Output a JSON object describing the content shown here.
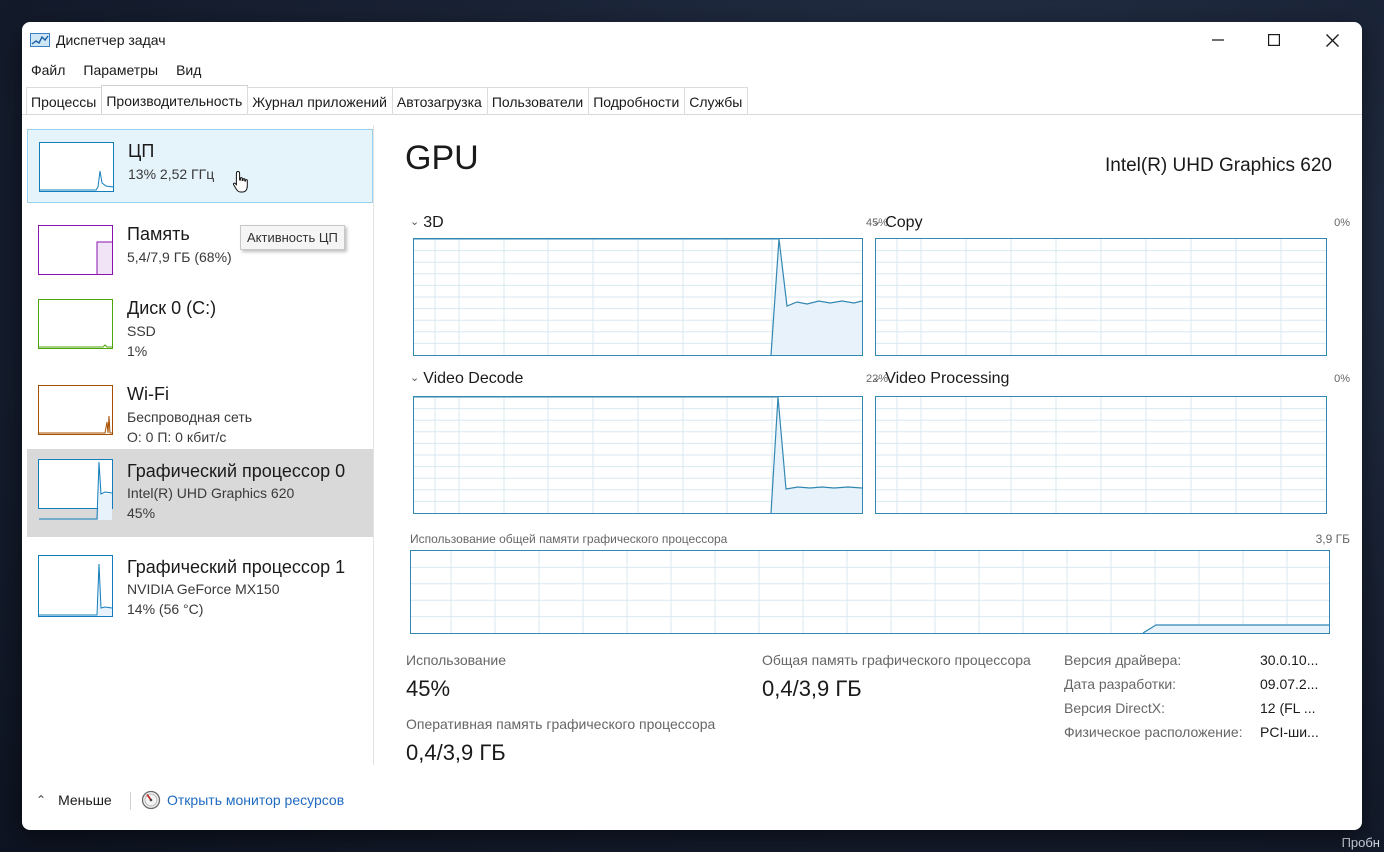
{
  "window": {
    "title": "Диспетчер задач"
  },
  "menu": [
    "Файл",
    "Параметры",
    "Вид"
  ],
  "tabs": [
    "Процессы",
    "Производительность",
    "Журнал приложений",
    "Автозагрузка",
    "Пользователи",
    "Подробности",
    "Службы"
  ],
  "sidebar": [
    {
      "name": "ЦП",
      "line1": "13%  2,52 ГГц",
      "line2": "",
      "color": "#117dbb"
    },
    {
      "name": "Память",
      "line1": "5,4/7,9 ГБ (68%)",
      "line2": "",
      "color": "#8b12ae"
    },
    {
      "name": "Диск 0 (C:)",
      "line1": "SSD",
      "line2": "1%",
      "color": "#4da60c"
    },
    {
      "name": "Wi-Fi",
      "line1": "Беспроводная сеть",
      "line2": "О: 0  П: 0 кбит/с",
      "color": "#a74f01"
    },
    {
      "name": "Графический процессор 0",
      "line1": "Intel(R) UHD Graphics 620",
      "line2": "45%",
      "color": "#117dbb"
    },
    {
      "name": "Графический процессор 1",
      "line1": "NVIDIA GeForce MX150",
      "line2": "14%  (56 °C)",
      "color": "#117dbb"
    }
  ],
  "tooltip": "Активность ЦП",
  "main": {
    "title": "GPU",
    "model": "Intel(R) UHD Graphics 620",
    "engines": [
      {
        "name": "3D",
        "percent": "45%"
      },
      {
        "name": "Copy",
        "percent": "0%"
      },
      {
        "name": "Video Decode",
        "percent": "22%"
      },
      {
        "name": "Video Processing",
        "percent": "0%"
      }
    ],
    "shared_memory": {
      "label": "Использование общей памяти графического процессора",
      "max": "3,9 ГБ"
    },
    "stats": {
      "usage_label": "Использование",
      "usage_value": "45%",
      "shared_label": "Общая память графического процессора",
      "shared_value": "0,4/3,9 ГБ",
      "dedicated_label": "Оперативная память графического процессора",
      "dedicated_value": "0,4/3,9 ГБ"
    },
    "info": [
      {
        "key": "Версия драйвера:",
        "value": "30.0.10..."
      },
      {
        "key": "Дата разработки:",
        "value": "09.07.2..."
      },
      {
        "key": "Версия DirectX:",
        "value": "12 (FL ..."
      },
      {
        "key": "Физическое расположение:",
        "value": "PCI-ши..."
      }
    ]
  },
  "footer": {
    "less": "Меньше",
    "monitor": "Открыть монитор ресурсов"
  },
  "desktop_text": "Пробн"
}
